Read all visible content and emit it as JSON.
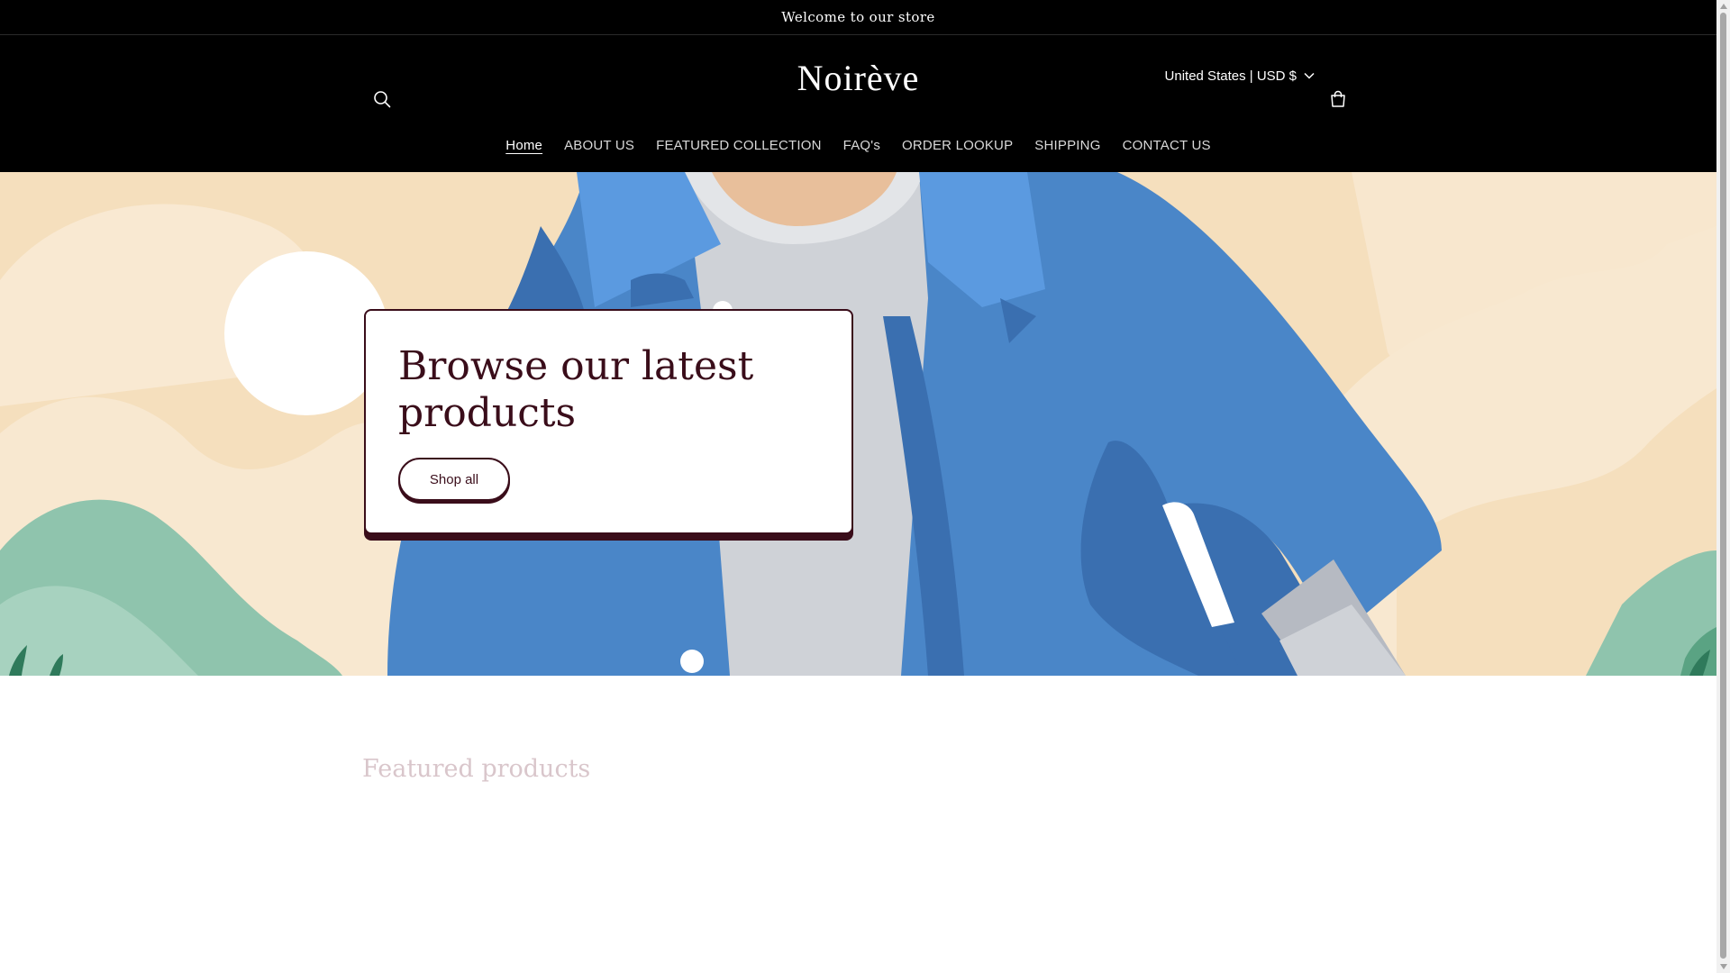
{
  "announcement": {
    "text": "Welcome to our store"
  },
  "header": {
    "logo": "Noirève",
    "country_selector": "United States | USD $",
    "search_icon": "search-icon",
    "cart_icon": "cart-icon"
  },
  "nav": {
    "items": [
      {
        "label": "Home",
        "active": true
      },
      {
        "label": "ABOUT US"
      },
      {
        "label": "FEATURED COLLECTION"
      },
      {
        "label": "FAQ's"
      },
      {
        "label": "ORDER LOOKUP"
      },
      {
        "label": "SHIPPING"
      },
      {
        "label": "CONTACT US"
      }
    ]
  },
  "hero": {
    "title": "Browse our latest products",
    "button_label": "Shop all"
  },
  "featured": {
    "title": "Featured products"
  },
  "colors": {
    "header_bg": "#000000",
    "accent": "#3a0d1a",
    "hero_sky": "#f5dfbd",
    "jacket_blue": "#4a86c8"
  }
}
